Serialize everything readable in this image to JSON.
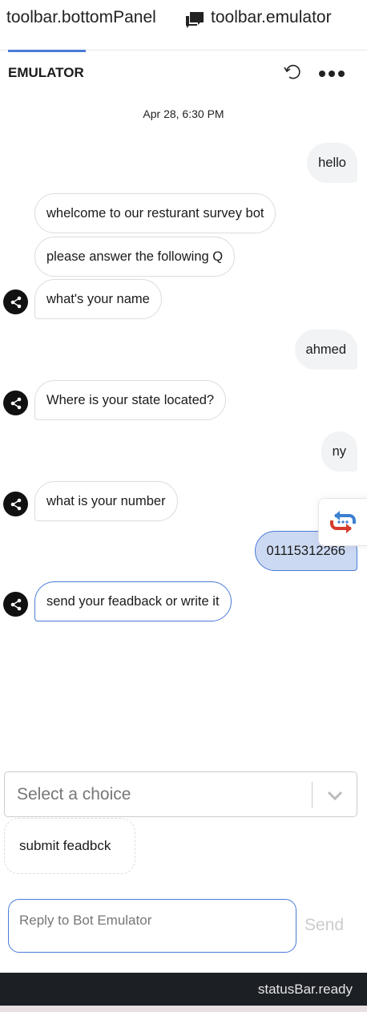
{
  "toolbar": {
    "bottomPanel": "toolbar.bottomPanel",
    "emulator": "toolbar.emulator"
  },
  "header": {
    "title": "EMULATOR",
    "icons": [
      "restart-icon",
      "more-icon"
    ]
  },
  "chat": {
    "timestamp": "Apr 28, 6:30 PM",
    "messages": [
      {
        "from": "user",
        "text": "hello"
      },
      {
        "from": "bot",
        "text": "whelcome to our resturant survey bot"
      },
      {
        "from": "bot",
        "text": "please answer the following Q"
      },
      {
        "from": "bot",
        "text": "what's your name"
      },
      {
        "from": "user",
        "text": "ahmed"
      },
      {
        "from": "bot",
        "text": "Where is your state located?"
      },
      {
        "from": "user",
        "text": "ny"
      },
      {
        "from": "bot",
        "text": "what is your number"
      },
      {
        "from": "user",
        "text": "01115312266"
      },
      {
        "from": "bot",
        "text": "send your feadback or write it"
      }
    ]
  },
  "choice": {
    "placeholder": "Select a choice",
    "submit": "submit feadbck"
  },
  "composer": {
    "placeholder": "Reply to Bot Emulator",
    "send": "Send"
  },
  "statusBar": {
    "text": "statusBar.ready"
  },
  "colors": {
    "accent": "#4a7bd8",
    "userSelected": "#ccd9f2",
    "statusBar": "#1c1f24"
  }
}
